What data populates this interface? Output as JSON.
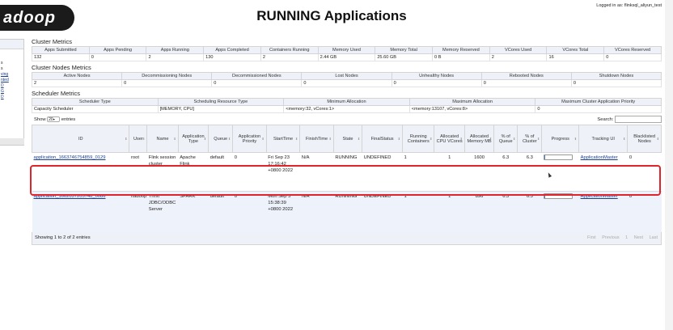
{
  "app": {
    "logo_text": "adoop",
    "title": "RUNNING Applications",
    "login": "Logged in as: flinksql_aliyun_test"
  },
  "nav": {
    "items": [
      "s",
      "s",
      "",
      "ving",
      "nted",
      "D",
      "G",
      "D"
    ]
  },
  "cluster_metrics": {
    "title": "Cluster Metrics",
    "headers": [
      "Apps Submitted",
      "Apps Pending",
      "Apps Running",
      "Apps Completed",
      "Containers Running",
      "Memory Used",
      "Memory Total",
      "Memory Reserved",
      "VCores Used",
      "VCores Total",
      "VCores Reserved"
    ],
    "values": [
      "132",
      "0",
      "2",
      "130",
      "2",
      "2.44 GB",
      "25.60 GB",
      "0 B",
      "2",
      "16",
      "0"
    ]
  },
  "node_metrics": {
    "title": "Cluster Nodes Metrics",
    "headers": [
      "Active Nodes",
      "Decommissioning Nodes",
      "Decommissioned Nodes",
      "Lost Nodes",
      "Unhealthy Nodes",
      "Rebooted Nodes",
      "Shutdown Nodes"
    ],
    "values": [
      "2",
      "0",
      "0",
      "0",
      "0",
      "0",
      "0"
    ]
  },
  "scheduler_metrics": {
    "title": "Scheduler Metrics",
    "headers": [
      "Scheduler Type",
      "Scheduling Resource Type",
      "Minimum Allocation",
      "Maximum Allocation",
      "Maximum Cluster Application Priority"
    ],
    "values": [
      "Capacity Scheduler",
      "[MEMORY, CPU]",
      "<memory:32, vCores:1>",
      "<memory:13107, vCores:8>",
      "0"
    ]
  },
  "table_controls": {
    "show_label": "Show",
    "entries_value": "20",
    "entries_label": "entries",
    "search_label": "Search:",
    "search_value": ""
  },
  "apps_table": {
    "headers": [
      "ID",
      "User",
      "Name",
      "Application Type",
      "Queue",
      "Application Priority",
      "StartTime",
      "FinishTime",
      "State",
      "FinalStatus",
      "Running Containers",
      "Allocated CPU VCores",
      "Allocated Memory MB",
      "% of Queue",
      "% of Cluster",
      "Progress",
      "Tracking UI",
      "Blacklisted Nodes"
    ],
    "rows": [
      {
        "id": "application_1663746754859_0129",
        "user": "root",
        "name": "Flink session cluster",
        "type": "Apache Flink",
        "queue": "default",
        "priority": "0",
        "start_time": "Fri Sep 23 17:16:42 +0800 2022",
        "finish_time": "N/A",
        "state": "RUNNING",
        "final_status": "UNDEFINED",
        "containers": "1",
        "vcores": "1",
        "memory_mb": "1600",
        "pct_queue": "6.3",
        "pct_cluster": "6.3",
        "progress": 0.02,
        "tracking_ui": "ApplicationMaster",
        "blacklisted": "0"
      },
      {
        "id": "application_1662037205748_0086",
        "user": "hadoop",
        "name": "Thrift JDBC/ODBC Server",
        "type": "SPARK",
        "queue": "default",
        "priority": "0",
        "start_time": "Mon Sep 5 15:38:39 +0800 2022",
        "finish_time": "N/A",
        "state": "RUNNING",
        "final_status": "UNDEFINED",
        "containers": "1",
        "vcores": "1",
        "memory_mb": "896",
        "pct_queue": "6.3",
        "pct_cluster": "6.3",
        "progress": 0.02,
        "tracking_ui": "ApplicationMaster",
        "blacklisted": "0"
      }
    ]
  },
  "footer": {
    "info": "Showing 1 to 2 of 2 entries",
    "first": "First",
    "previous": "Previous",
    "page": "1",
    "next": "Next",
    "last": "Last"
  },
  "colors": {
    "highlight": "#e0242c",
    "link": "#1a3d8f",
    "header_bg": "#eef2f8"
  }
}
